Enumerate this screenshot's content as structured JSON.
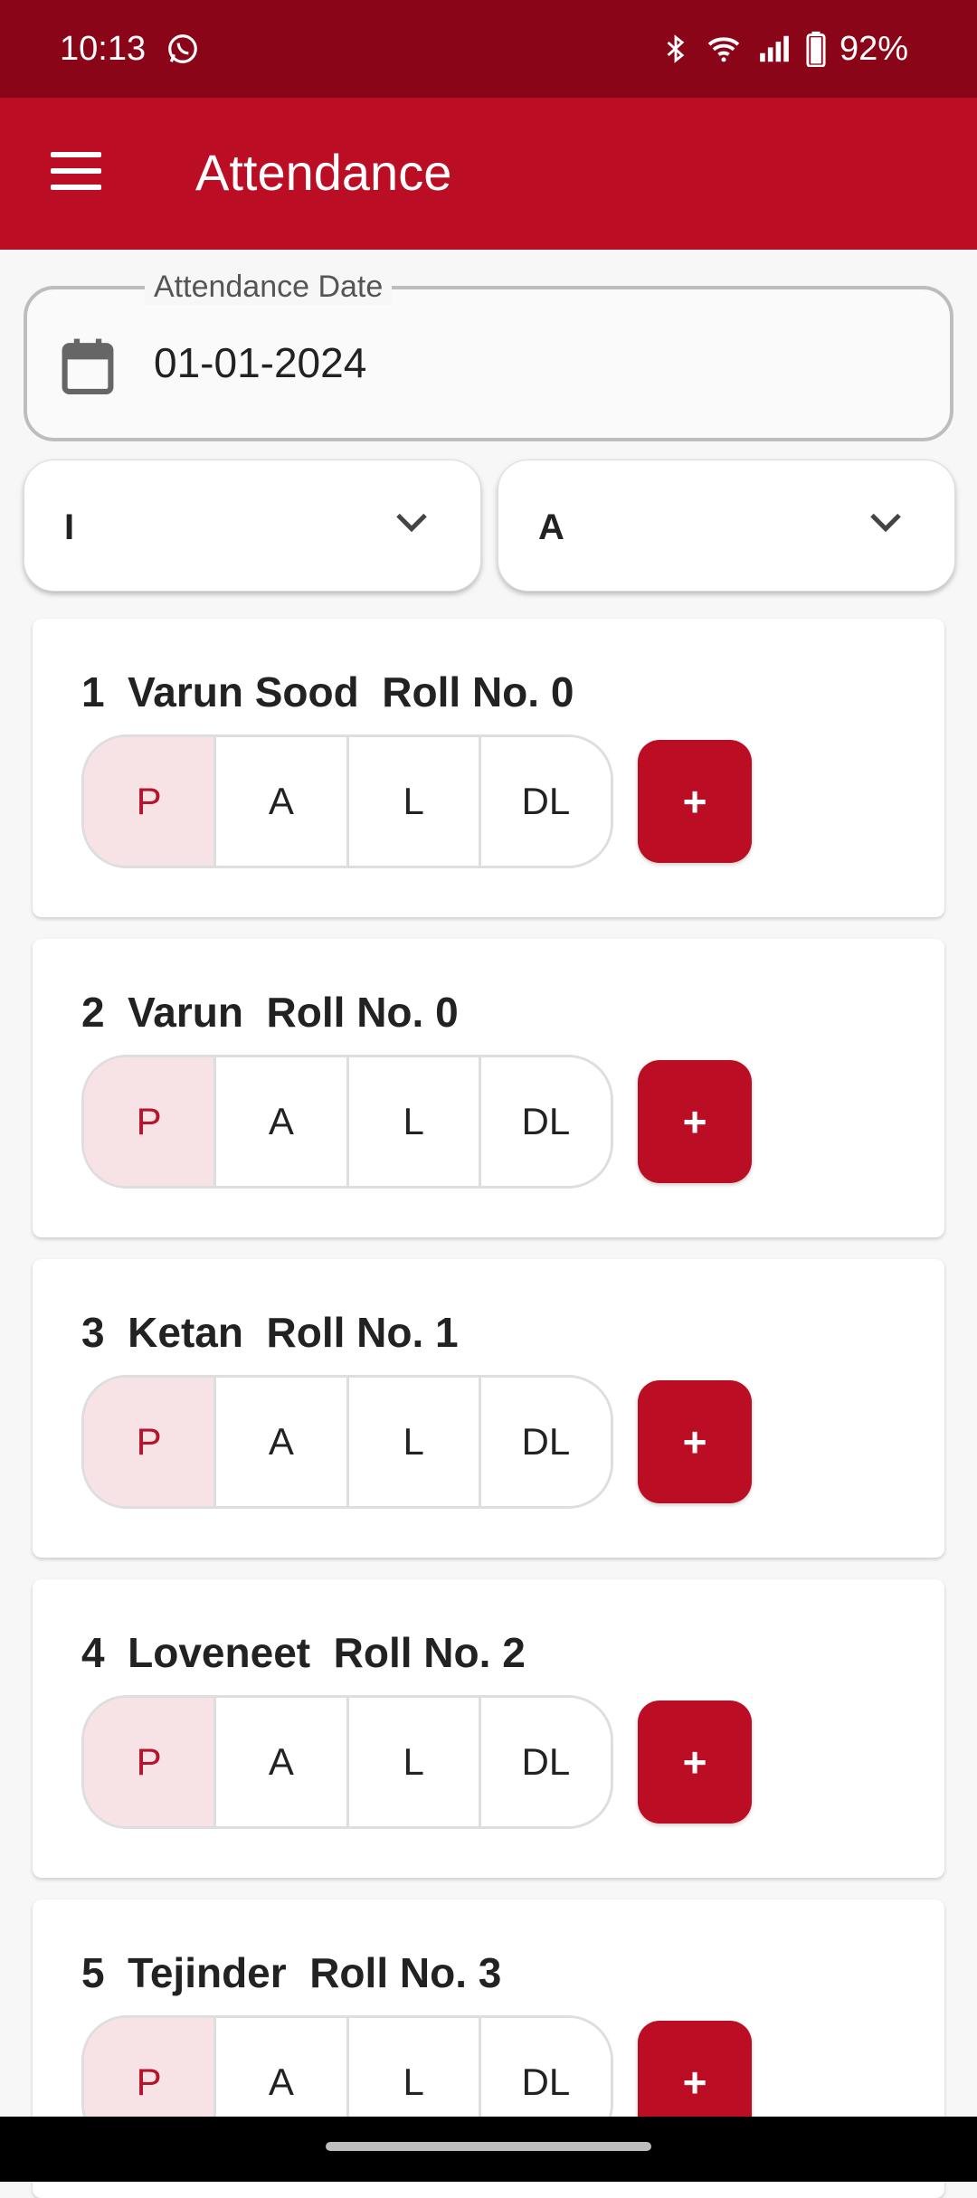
{
  "status": {
    "time": "10:13",
    "battery": "92%",
    "icons": [
      "whatsapp-icon",
      "bluetooth-icon",
      "wifi-icon",
      "signal-icon",
      "battery-icon"
    ]
  },
  "app_bar": {
    "title": "Attendance"
  },
  "date_field": {
    "label": "Attendance Date",
    "value": "01-01-2024"
  },
  "filters": {
    "class_value": "I",
    "section_value": "A"
  },
  "options": [
    "P",
    "A",
    "L",
    "DL"
  ],
  "add_label": "+",
  "students": [
    {
      "title": "1  Varun Sood  Roll No. 0",
      "selected": "P"
    },
    {
      "title": "2  Varun  Roll No. 0",
      "selected": "P"
    },
    {
      "title": "3  Ketan  Roll No. 1",
      "selected": "P"
    },
    {
      "title": "4  Loveneet  Roll No. 2",
      "selected": "P"
    },
    {
      "title": "5  Tejinder  Roll No. 3",
      "selected": "P"
    }
  ],
  "colors": {
    "primary": "#bb0d23",
    "status_bar": "#8b0519",
    "selected_bg": "#f7e2e5"
  }
}
